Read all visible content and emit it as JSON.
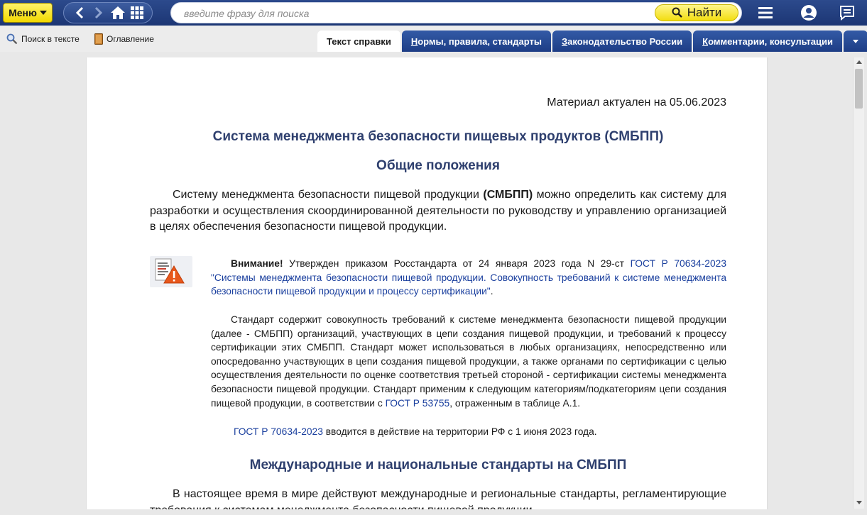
{
  "toolbar": {
    "menu_label": "Меню",
    "search_placeholder": "введите фразу для поиска",
    "find_label": "Найти"
  },
  "subbar": {
    "search_in_text": "Поиск в тексте",
    "contents": "Оглавление"
  },
  "tabs": [
    {
      "label": "Текст справки",
      "active": true
    },
    {
      "label": "Нормы, правила, стандарты",
      "underline": "Н",
      "rest": "ормы, правила, стандарты"
    },
    {
      "label": "Законодательство России",
      "underline": "З",
      "rest": "аконодательство России"
    },
    {
      "label": "Комментарии, консультации",
      "underline": "К",
      "rest": "омментарии, консультации"
    }
  ],
  "doc": {
    "date": "Материал актуален на 05.06.2023",
    "title": "Система менеджмента безопасности пищевых продуктов (СМБПП)",
    "section1": "Общие положения",
    "p1_a": "Систему менеджмента безопасности пищевой продукции ",
    "p1_b": "(СМБПП)",
    "p1_c": " можно определить как систему для разработки и осуществления скоординированной деятельности по руководству и управлению организацией в целях обеспечения безопасности пищевой продукции.",
    "note1_bold": "Внимание!",
    "note1_text": " Утвержден приказом Росстандарта от 24 января 2023 года N 29-ст ",
    "note1_link": "ГОСТ Р 70634-2023 \"Системы менеджмента безопасности пищевой продукции. Совокупность требований к системе менеджмента безопасности пищевой продукции и процессу сертификации\"",
    "note1_end": ".",
    "note2_text": "Стандарт содержит совокупность требований к системе менеджмента безопасности пищевой продукции (далее - СМБПП) организаций, участвующих в цепи создания пищевой продукции, и требований к процессу сертификации этих СМБПП. Стандарт может использоваться в любых организациях, непосредственно или опосредованно участвующих в цепи создания пищевой продукции, а также органами по сертификации с целью осуществления деятельности по оценке соответствия третьей стороной - сертификации системы менеджмента безопасности пищевой продукции. Стандарт применим к следующим категориям/подкатегориям цепи создания пищевой продукции, в соответствии с ",
    "note2_link": "ГОСТ Р 53755",
    "note2_end": ", отраженным в таблице А.1.",
    "note3_link": "ГОСТ Р 70634-2023",
    "note3_text": " вводится в действие на территории РФ с 1 июня 2023 года.",
    "section2": "Международные и национальные стандарты на СМБПП",
    "p2": "В настоящее время в мире действуют международные и региональные стандарты, регламентирующие требования к системам менеджмента безопасности пищевой продукции."
  }
}
